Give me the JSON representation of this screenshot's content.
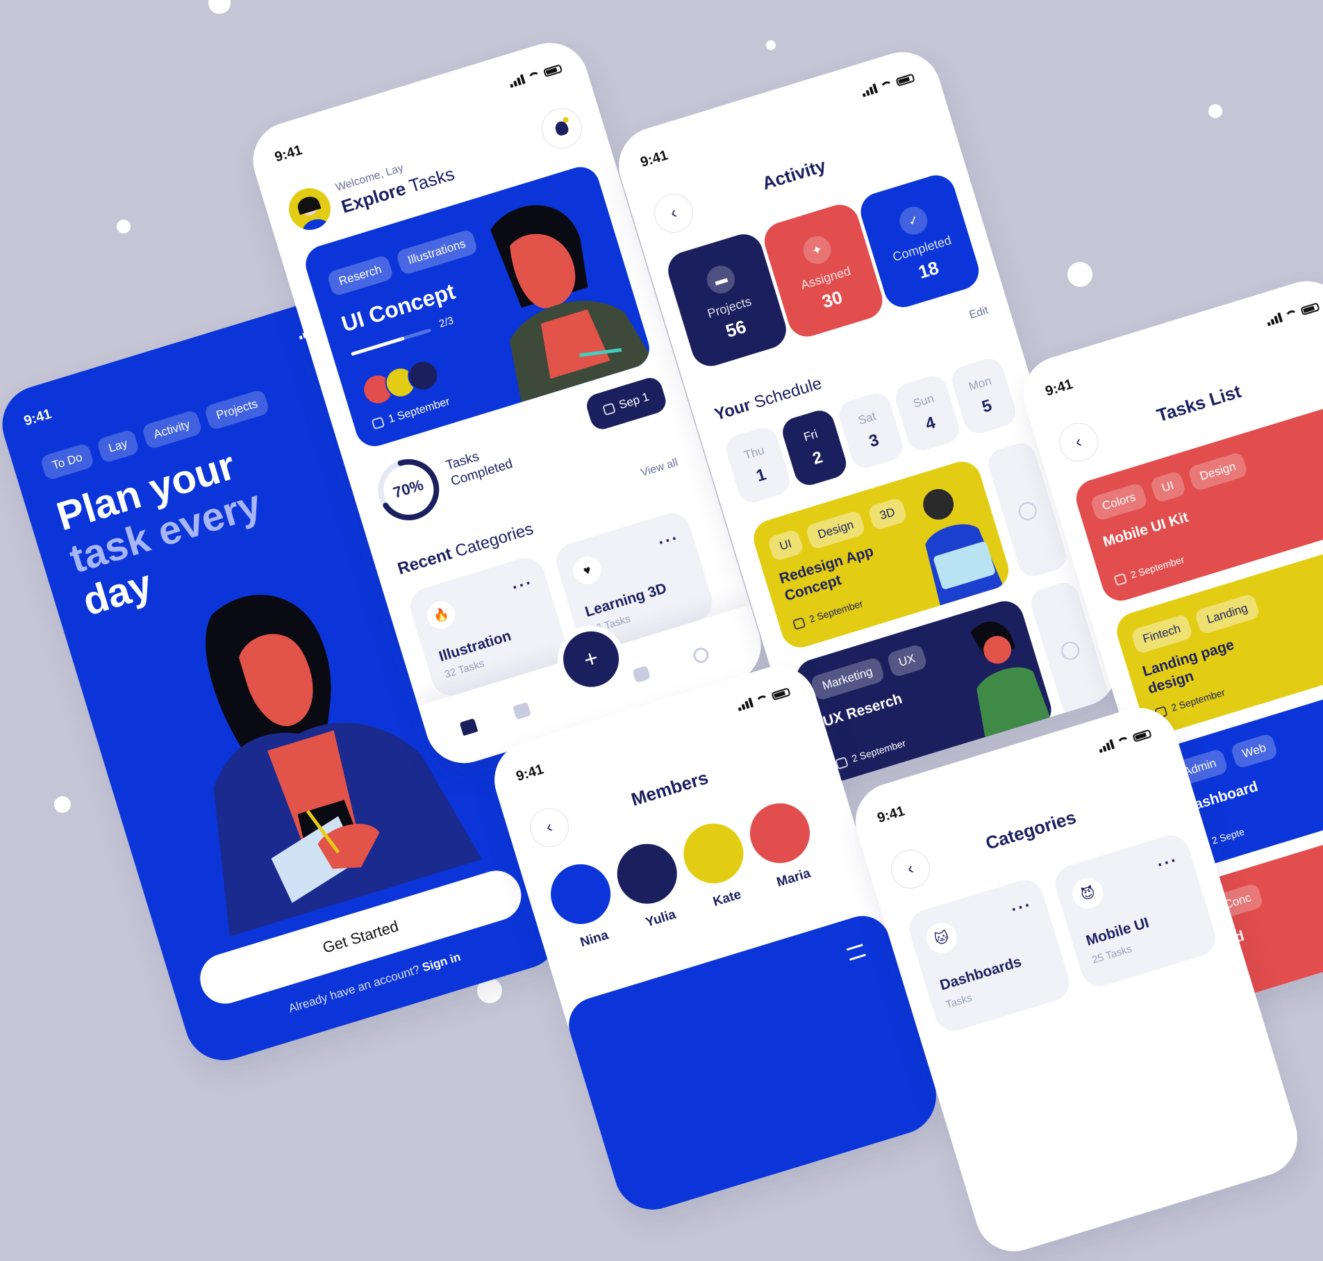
{
  "colors": {
    "background": "#c5c5d6",
    "primary_blue": "#0b35d8",
    "navy": "#1b1f5e",
    "coral": "#e24d4d",
    "yellow": "#e3cd14",
    "white": "#ffffff"
  },
  "status_time": "9:41",
  "onboarding": {
    "chips": [
      "To Do",
      "Lay",
      "Activity",
      "Projects"
    ],
    "headline_1": "Plan your",
    "headline_2": "task every",
    "headline_3": "day",
    "cta_label": "Get Started",
    "signin_text": "Already have an account?",
    "signin_link": "Sign in"
  },
  "home": {
    "welcome": "Welcome, Lay",
    "heading_bold": "Explore",
    "heading_light": "Tasks",
    "hero": {
      "tags": [
        "Reserch",
        "Illustrations"
      ],
      "title": "UI Concept",
      "progress_text": "2/3",
      "progress_fraction": 0.67,
      "date": "1 September"
    },
    "date_button": "Sep 1",
    "tasks_percent": "70%",
    "tasks_percent_value": 0.7,
    "tasks_label_1": "Tasks",
    "tasks_label_2": "Completed",
    "view_all": "View all",
    "recent_bold": "Recent",
    "recent_light": "Categories",
    "categories": [
      {
        "icon": "fire-icon",
        "glyph": "🔥",
        "name": "Illustration",
        "count": "32 Tasks"
      },
      {
        "icon": "heart-icon",
        "glyph": "♥",
        "name": "Learning 3D",
        "count": "16 Tasks"
      }
    ],
    "fab": "+"
  },
  "activity": {
    "title": "Activity",
    "stats": [
      {
        "label": "Projects",
        "value": "56",
        "icon": "folder-icon"
      },
      {
        "label": "Assigned",
        "value": "30",
        "icon": "star-icon"
      },
      {
        "label": "Completed",
        "value": "18",
        "icon": "check-icon"
      }
    ],
    "edit": "Edit",
    "schedule_bold": "Your",
    "schedule_light": "Schedule",
    "days": [
      {
        "name": "Thu",
        "num": "1"
      },
      {
        "name": "Fri",
        "num": "2"
      },
      {
        "name": "Sat",
        "num": "3"
      },
      {
        "name": "Sun",
        "num": "4"
      },
      {
        "name": "Mon",
        "num": "5"
      }
    ],
    "tasks": [
      {
        "tags": [
          "UI",
          "Design",
          "3D"
        ],
        "title_1": "Redesign App",
        "title_2": "Concept",
        "date": "2 September"
      },
      {
        "tags": [
          "Marketing",
          "UX"
        ],
        "title_1": "UX Reserch",
        "title_2": "",
        "date": "2 September"
      }
    ]
  },
  "tasks_list": {
    "title": "Tasks List",
    "items": [
      {
        "tags": [
          "Colors",
          "UI",
          "Design"
        ],
        "title_1": "Mobile UI Kit",
        "title_2": "",
        "date": "2 September"
      },
      {
        "tags": [
          "Fintech",
          "Landing"
        ],
        "title_1": "Landing page",
        "title_2": "design",
        "date": "2 September"
      },
      {
        "tags": [
          "Admin",
          "Web"
        ],
        "title_1": "Dashboard",
        "title_2": "",
        "date": "2 Septe"
      },
      {
        "tags": [
          "Conc"
        ],
        "title_1": "Ad",
        "title_2": "",
        "date": ""
      }
    ]
  },
  "members": {
    "title": "Members",
    "people": [
      {
        "name": "Nina"
      },
      {
        "name": "Yulia"
      },
      {
        "name": "Kate"
      },
      {
        "name": "Maria"
      }
    ]
  },
  "categories_screen": {
    "title": "Categories",
    "items": [
      {
        "glyph": "🐱",
        "icon": "cat-icon",
        "name": "Dashboards",
        "count": "Tasks"
      },
      {
        "glyph": "😈",
        "icon": "devil-icon",
        "name": "Mobile UI",
        "count": "25 Tasks"
      }
    ]
  }
}
